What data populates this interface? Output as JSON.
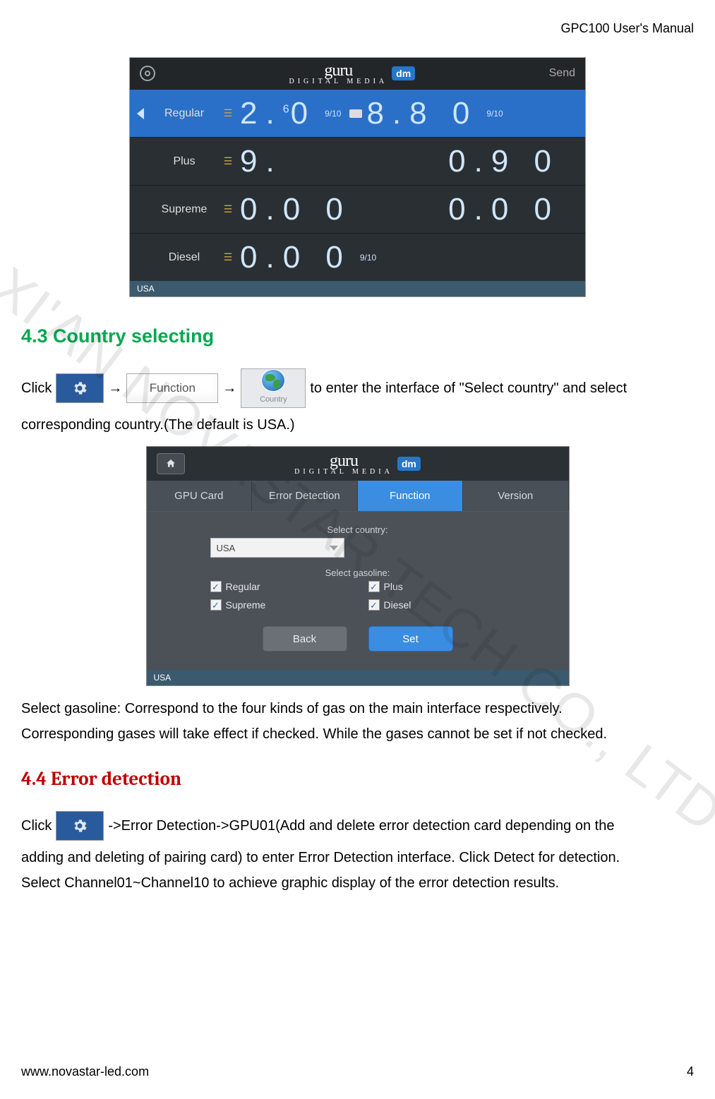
{
  "doc": {
    "header": "GPC100 User's Manual",
    "footer_url": "www.novastar-led.com",
    "page_number": "4",
    "watermark": "XI'AN NOVASTAR TECH CO., LTD"
  },
  "shot1": {
    "logo_brand": "guru",
    "logo_dm": "dm",
    "logo_sub": "DIGITAL MEDIA",
    "send": "Send",
    "rows": [
      {
        "label": "Regular",
        "cash": "2.",
        "cash_sup": "6",
        "cash_rest": "0",
        "frac": "9/10",
        "card": "8.8 0",
        "frac2": "9/10"
      },
      {
        "label": "Plus",
        "cash": "9.",
        "cash_rest": "",
        "card": "0.9 0"
      },
      {
        "label": "Supreme",
        "cash": "0.0 0",
        "card": "0.0 0"
      },
      {
        "label": "Diesel",
        "cash": "0.0 0",
        "frac": "9/10",
        "card": ""
      }
    ],
    "footer": "USA"
  },
  "section43": {
    "title": "4.3 Country selecting",
    "line1_a": "Click",
    "arrow": "→",
    "function_label": "Function",
    "country_label": "Country",
    "line1_b": "to enter the interface of \"Select country\" and select",
    "line2": "corresponding country.(The default is USA.)",
    "line3": "Select gasoline: Correspond to the four kinds of gas on the main interface respectively.",
    "line4": "Corresponding gases will take effect if checked. While the gases cannot be set if not checked."
  },
  "shot2": {
    "logo_brand": "guru",
    "logo_dm": "dm",
    "logo_sub": "DIGITAL MEDIA",
    "tabs": [
      "GPU Card",
      "Error Detection",
      "Function",
      "Version"
    ],
    "active_tab_index": 2,
    "select_country_label": "Select country:",
    "country_value": "USA",
    "select_gasoline_label": "Select gasoline:",
    "checks": [
      "Regular",
      "Plus",
      "Supreme",
      "Diesel"
    ],
    "back": "Back",
    "set": "Set",
    "footer": "USA"
  },
  "section44": {
    "title": "4.4 Error detection",
    "line1_a": "Click",
    "line1_b": "->Error Detection->GPU01(Add and delete error detection card depending on the",
    "line2": "adding and deleting of pairing card) to enter Error Detection interface. Click Detect for detection.",
    "line3": "Select Channel01~Channel10 to achieve graphic display of the error detection results."
  }
}
